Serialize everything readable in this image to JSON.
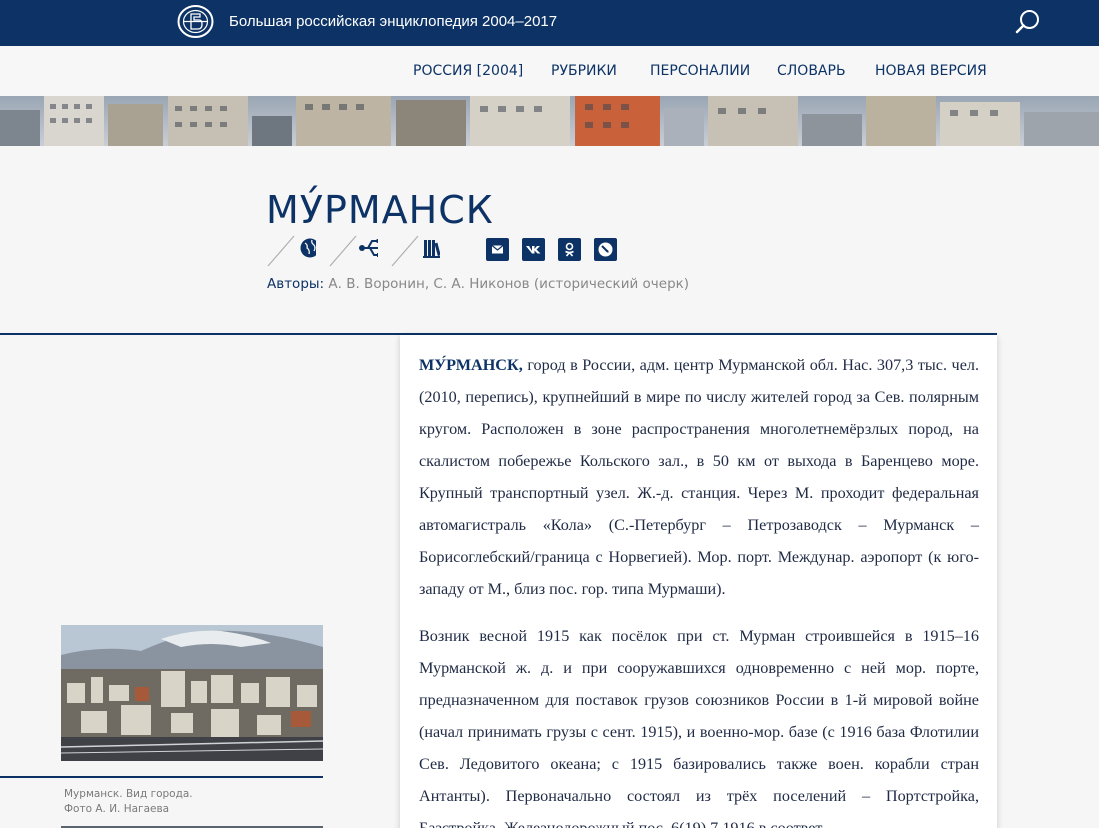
{
  "header": {
    "site_title": "Большая российская энциклопедия 2004–2017",
    "logo_icon": "bre-logo-icon",
    "search_icon": "search-icon"
  },
  "nav": {
    "items": [
      {
        "label": "РОССИЯ [2004]"
      },
      {
        "label": "РУБРИКИ"
      },
      {
        "label": "ПЕРСОНАЛИИ"
      },
      {
        "label": "СЛОВАРЬ"
      },
      {
        "label": "НОВАЯ ВЕРСИЯ"
      }
    ]
  },
  "article": {
    "title": "МУ́РМАНСК",
    "tools": [
      "globe-icon",
      "usb-icon",
      "library-icon"
    ],
    "share": [
      "mail-icon",
      "vk-icon",
      "odnoklassniki-icon",
      "livejournal-icon"
    ],
    "authors_label": "Авторы:",
    "authors": "А. В. Воронин, С. А. Никонов (исторический очерк)",
    "lead": "МУ́РМАНСК,",
    "p1": "город в России, адм. центр Мурманской обл. Нас. 307,3 тыс. чел. (2010, перепись), крупнейший в мире по числу жителей город за Сев. полярным кругом. Расположен в зоне распространения многолетнемёрзлых пород, на скалистом побережье Кольского зал., в 50 км от выхода в Баренцево море. Крупный транспортный узел. Ж.-д. станция. Через М. проходит федеральная автомагистраль «Кола» (С.-Петербург – Петрозаводск – Мурманск – Борисоглебский/граница с Норвегией). Мор. порт. Междунар. аэропорт (к юго-западу от М., близ пос. гор. типа Мурмаши).",
    "p2": "Возник весной 1915 как посёлок при ст. Мурман строившейся в 1915–16 Мурманской ж. д. и при сооружавшихся одновременно с ней мор. порте, предназначенном для поставок грузов союзников России в 1-й мировой войне (начал принимать грузы с сент. 1915), и военно-мор. базе (с 1916 база Флотилии Сев. Ледовитого океана; с 1915 базировались также воен. корабли стран Антанты). Первоначально состоял из трёх поселений – Портстройка, Базстройка, Железнодорожный пос. 6(19).7.1916 в соответ-"
  },
  "figure": {
    "caption_line1": "Мурманск. Вид города.",
    "caption_line2": "Фото А. И. Нагаева"
  },
  "colors": {
    "brand": "#0d3366",
    "background": "#f6f6f6",
    "muted": "#888888"
  }
}
